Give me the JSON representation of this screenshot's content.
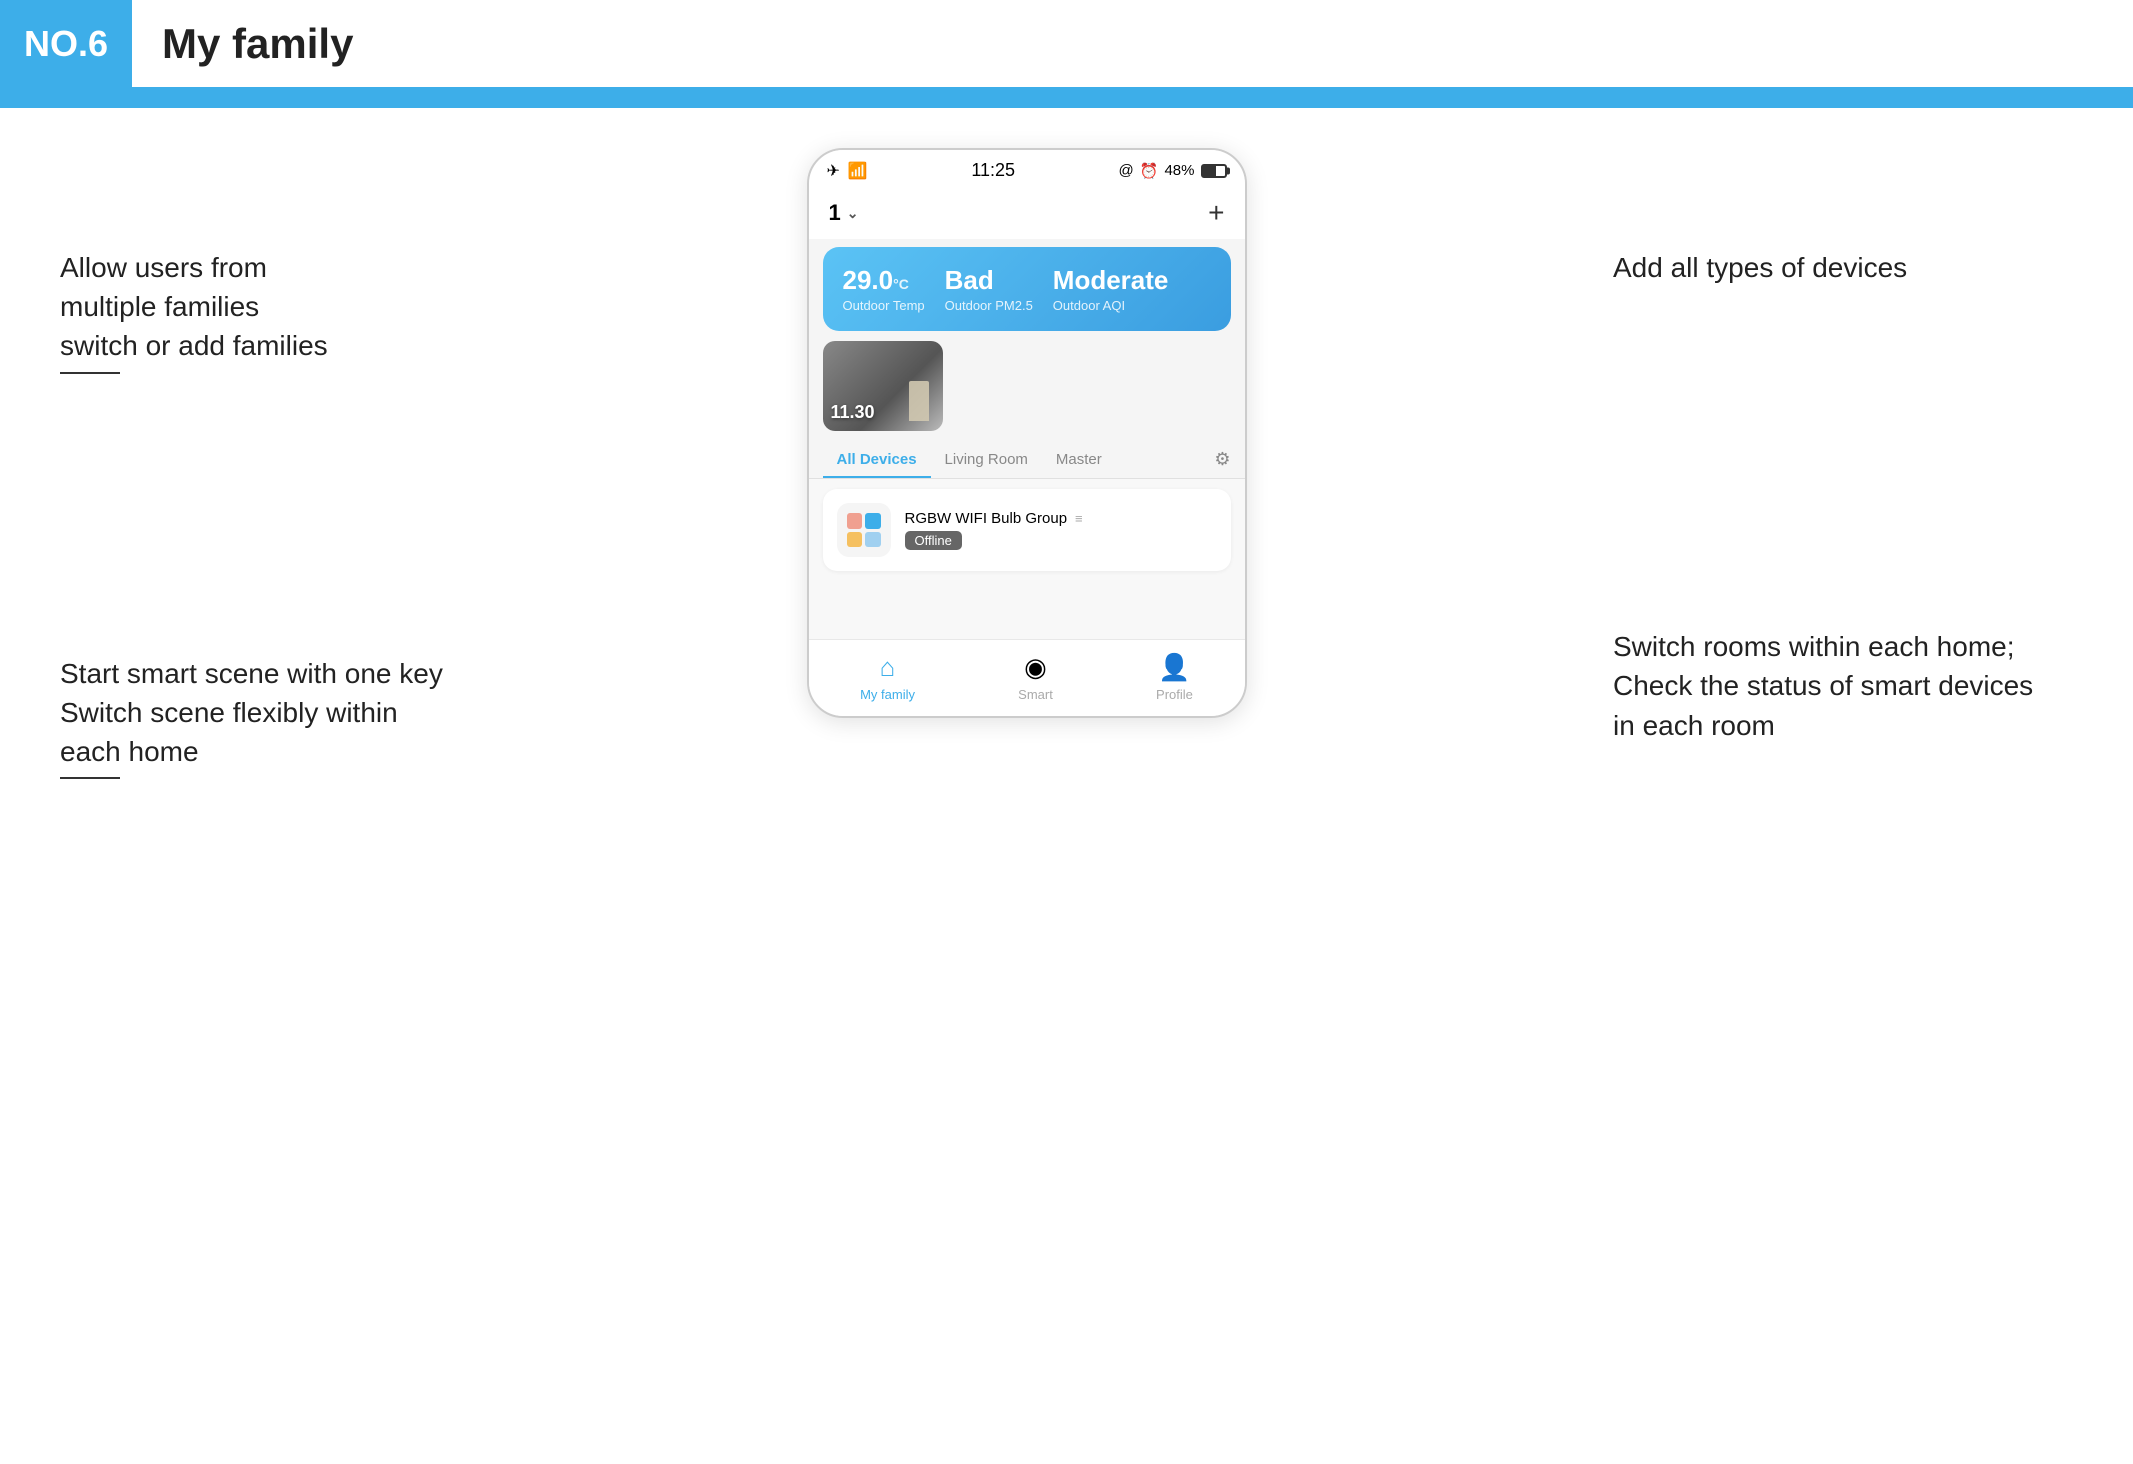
{
  "header": {
    "badge": "NO.6",
    "title": "My family"
  },
  "annotations": {
    "left_top": "Allow users from\nmultiple families\nswitch or add families",
    "left_middle": "Start smart scene with one key\nSwitch scene flexibly within\neach home",
    "right_top": "Add all types of devices",
    "right_bottom": "Switch rooms within each home;\nCheck the status of smart devices\nin each room"
  },
  "phone": {
    "statusBar": {
      "time": "11:25",
      "battery": "48%"
    },
    "familyNumber": "1",
    "weatherCard": {
      "temp": "29.0",
      "tempUnit": "°C",
      "tempLabel": "Outdoor Temp",
      "pm25Value": "Bad",
      "pm25Label": "Outdoor PM2.5",
      "aqiValue": "Moderate",
      "aqiLabel": "Outdoor AQI"
    },
    "sceneTime": "11.30",
    "tabs": [
      {
        "label": "All Devices",
        "active": true
      },
      {
        "label": "Living Room",
        "active": false
      },
      {
        "label": "Master",
        "active": false
      }
    ],
    "devices": [
      {
        "name": "RGBW WIFI Bulb Group",
        "status": "Offline"
      }
    ],
    "bottomNav": [
      {
        "label": "My family",
        "active": true,
        "icon": "home"
      },
      {
        "label": "Smart",
        "active": false,
        "icon": "smart"
      },
      {
        "label": "Profile",
        "active": false,
        "icon": "person"
      }
    ]
  }
}
